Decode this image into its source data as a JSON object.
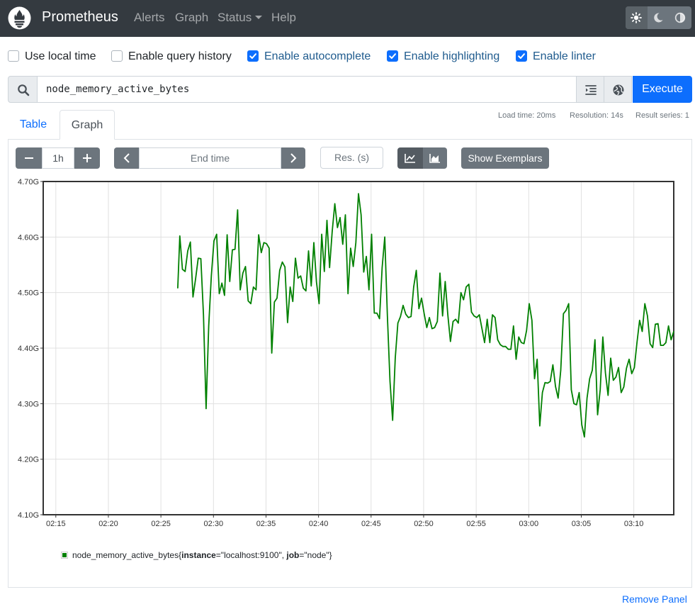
{
  "navbar": {
    "brand": "Prometheus",
    "links": [
      "Alerts",
      "Graph",
      "Status",
      "Help"
    ],
    "theme_icons": [
      "sun-icon",
      "moon-icon",
      "adjust-icon"
    ],
    "background": "#343a40"
  },
  "options": [
    {
      "label": "Use local time",
      "checked": false
    },
    {
      "label": "Enable query history",
      "checked": false
    },
    {
      "label": "Enable autocomplete",
      "checked": true
    },
    {
      "label": "Enable highlighting",
      "checked": true
    },
    {
      "label": "Enable linter",
      "checked": true
    }
  ],
  "expression": {
    "value": "node_memory_active_bytes",
    "execute_label": "Execute",
    "icons": [
      "search-icon",
      "format-icon",
      "metrics-explorer-icon"
    ]
  },
  "stats": {
    "load_time": "Load time: 20ms",
    "resolution": "Resolution: 14s",
    "result_series": "Result series: 1"
  },
  "tabs": [
    {
      "label": "Table",
      "active": false
    },
    {
      "label": "Graph",
      "active": true
    }
  ],
  "graph_controls": {
    "minus": "−",
    "range": "1h",
    "plus": "+",
    "end_time_placeholder": "End time",
    "resolution_placeholder": "Res. (s)",
    "show_exemplars": "Show Exemplars",
    "chart_mode_icons": [
      "line-chart-icon",
      "area-chart-icon"
    ]
  },
  "chart_data": {
    "type": "line",
    "title": "",
    "xlabel": "",
    "ylabel": "",
    "x_tick_labels": [
      "02:15",
      "02:20",
      "02:25",
      "02:30",
      "02:35",
      "02:40",
      "02:45",
      "02:50",
      "02:55",
      "03:00",
      "03:05",
      "03:10"
    ],
    "y_tick_labels": [
      "4.10G",
      "4.20G",
      "4.30G",
      "4.40G",
      "4.50G",
      "4.60G",
      "4.70G"
    ],
    "xlim_minutes_after_0215": [
      -1.2,
      58.8
    ],
    "ylim": [
      4.1,
      4.7
    ],
    "y_unit": "G (bytes)",
    "grid": true,
    "series": [
      {
        "name": "node_memory_active_bytes{instance=\"localhost:9100\", job=\"node\"}",
        "color": "#008000",
        "x_minutes_after_0215": [
          11.6,
          11.8,
          12.05,
          12.3,
          12.55,
          12.8,
          13.05,
          13.3,
          13.55,
          13.8,
          14.05,
          14.3,
          14.55,
          14.8,
          15.05,
          15.3,
          15.55,
          15.8,
          16.05,
          16.3,
          16.55,
          16.8,
          17.05,
          17.3,
          17.55,
          17.8,
          18.05,
          18.3,
          18.55,
          18.8,
          19.05,
          19.3,
          19.55,
          19.8,
          20.05,
          20.3,
          20.55,
          20.8,
          21.05,
          21.3,
          21.55,
          21.8,
          22.05,
          22.3,
          22.55,
          22.8,
          23.05,
          23.3,
          23.55,
          23.8,
          24.05,
          24.3,
          24.55,
          24.8,
          25.05,
          25.3,
          25.55,
          25.8,
          26.05,
          26.3,
          26.55,
          26.8,
          27.05,
          27.3,
          27.55,
          27.8,
          28.05,
          28.3,
          28.55,
          28.8,
          29.05,
          29.3,
          29.55,
          29.8,
          30.05,
          30.3,
          30.55,
          30.8,
          31.05,
          31.3,
          31.55,
          31.8,
          32.05,
          32.3,
          32.55,
          32.8,
          33.05,
          33.3,
          33.55,
          33.8,
          34.05,
          34.3,
          34.55,
          34.8,
          35.05,
          35.3,
          35.55,
          35.8,
          36.05,
          36.3,
          36.55,
          36.8,
          37.05,
          37.3,
          37.55,
          37.8,
          38.05,
          38.3,
          38.55,
          38.8,
          39.05,
          39.3,
          39.55,
          39.8,
          40.05,
          40.3,
          40.55,
          40.8,
          41.05,
          41.3,
          41.55,
          41.8,
          42.05,
          42.3,
          42.55,
          42.8,
          43.05,
          43.3,
          43.55,
          43.8,
          44.05,
          44.3,
          44.55,
          44.8,
          45.05,
          45.3,
          45.55,
          45.8,
          46.05,
          46.3,
          46.55,
          46.8,
          47.05,
          47.3,
          47.55,
          47.8,
          48.05,
          48.3,
          48.55,
          48.8,
          49.05,
          49.3,
          49.55,
          49.8,
          50.05,
          50.3,
          50.55,
          50.8,
          51.05,
          51.3,
          51.55,
          51.8,
          52.05,
          52.3,
          52.55,
          52.8,
          53.05,
          53.3,
          53.55,
          53.8,
          54.05,
          54.3,
          54.55,
          54.8,
          55.05,
          55.3,
          55.55,
          55.8,
          56.05,
          56.3,
          56.55,
          56.8,
          57.05,
          57.3,
          57.55,
          57.8,
          58.05,
          58.3,
          58.55,
          58.8
        ],
        "values": [
          4.508,
          4.602,
          4.542,
          4.538,
          4.575,
          4.591,
          4.492,
          4.525,
          4.562,
          4.561,
          4.46,
          4.291,
          4.44,
          4.53,
          4.593,
          4.605,
          4.498,
          4.517,
          4.495,
          4.604,
          4.52,
          4.577,
          4.578,
          4.649,
          4.505,
          4.535,
          4.547,
          4.485,
          4.48,
          4.51,
          4.505,
          4.604,
          4.572,
          4.59,
          4.588,
          4.58,
          4.391,
          4.483,
          4.49,
          4.54,
          4.555,
          4.546,
          4.446,
          4.51,
          4.484,
          4.562,
          4.526,
          4.53,
          4.508,
          4.503,
          4.575,
          4.512,
          4.59,
          4.519,
          4.48,
          4.605,
          4.538,
          4.63,
          4.545,
          4.61,
          4.66,
          4.617,
          4.635,
          4.587,
          4.64,
          4.498,
          4.58,
          4.547,
          4.59,
          4.678,
          4.64,
          4.537,
          4.565,
          4.505,
          4.605,
          4.463,
          4.463,
          4.453,
          4.545,
          4.6,
          4.458,
          4.34,
          4.27,
          4.382,
          4.445,
          4.457,
          4.477,
          4.461,
          4.455,
          4.457,
          4.51,
          4.54,
          4.471,
          4.49,
          4.462,
          4.437,
          4.455,
          4.435,
          4.437,
          4.448,
          4.535,
          4.458,
          4.52,
          4.46,
          4.412,
          4.448,
          4.452,
          4.445,
          4.5,
          4.487,
          4.51,
          4.515,
          4.465,
          4.458,
          4.455,
          4.46,
          4.435,
          4.41,
          4.452,
          4.41,
          4.46,
          4.455,
          4.415,
          4.406,
          4.403,
          4.403,
          4.398,
          4.398,
          4.44,
          4.38,
          4.42,
          4.41,
          4.408,
          4.432,
          4.48,
          4.45,
          4.345,
          4.38,
          4.26,
          4.32,
          4.338,
          4.337,
          4.34,
          4.37,
          4.331,
          4.31,
          4.36,
          4.462,
          4.468,
          4.48,
          4.325,
          4.3,
          4.298,
          4.32,
          4.262,
          4.24,
          4.31,
          4.345,
          4.36,
          4.415,
          4.28,
          4.325,
          4.42,
          4.355,
          4.315,
          4.382,
          4.342,
          4.348,
          4.365,
          4.32,
          4.33,
          4.364,
          4.38,
          4.354,
          4.365,
          4.41,
          4.45,
          4.43,
          4.48,
          4.458,
          4.408,
          4.401,
          4.443,
          4.444,
          4.405,
          4.405,
          4.41,
          4.44,
          4.415,
          4.43,
          4.422,
          4.49,
          4.44,
          4.455
        ]
      }
    ]
  },
  "legend": {
    "metric": "node_memory_active_bytes",
    "open_brace": "{",
    "label1_key": "instance",
    "label1_value": "=\"localhost:9100\", ",
    "label2_key": "job",
    "label2_value": "=\"node\"}"
  },
  "remove_panel": "Remove Panel"
}
